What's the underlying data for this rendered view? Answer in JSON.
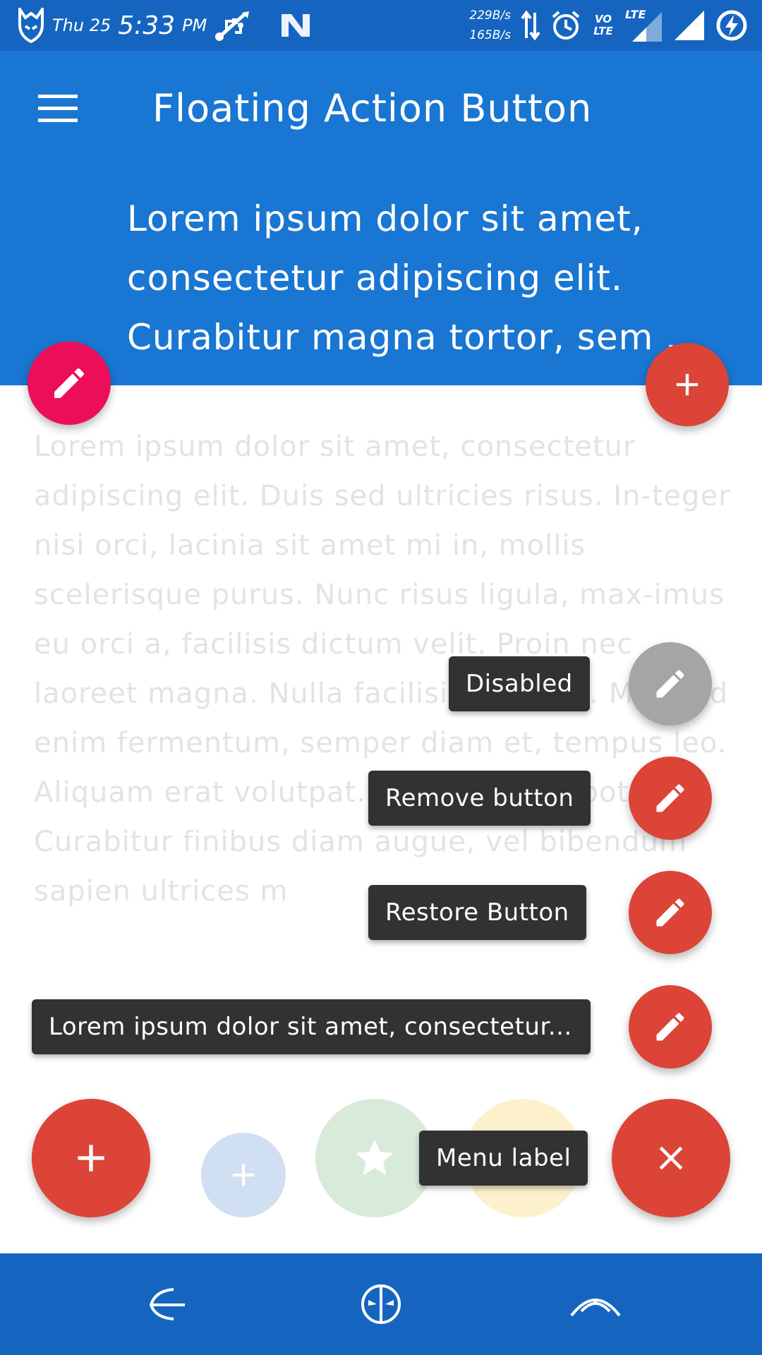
{
  "status_bar": {
    "day": "Thu 25",
    "time": "5:33",
    "ampm": "PM",
    "speed_up": "229B/s",
    "speed_down": "165B/s",
    "icons": [
      "app-logo-icon",
      "usb-icon",
      "n-icon",
      "data-arrows-icon",
      "alarm-icon",
      "volte-icon",
      "lte-signal-icon",
      "signal-icon",
      "battery-charging-icon"
    ],
    "volte_label": "VO LTE",
    "lte_label": "LTE"
  },
  "app_bar": {
    "title": "Floating Action Button",
    "header_text": [
      "Lorem ipsum dolor sit amet,",
      "consectetur adipiscing elit.",
      "Curabitur magna tortor, sem ..."
    ],
    "color": "#1976d2"
  },
  "body_text": "Lorem ipsum dolor sit amet, consectetur adipiscing elit. Duis sed ultricies risus. In-teger nisi orci, lacinia sit amet mi in, mollis scelerisque purus. Nunc risus ligula, max-imus eu orci a, facilisis dictum velit. Proin nec laoreet magna. Nulla facilisis lectus a. Morbi id enim fermentum, semper diam et, tempus leo. Aliquam erat volutpat. Sus-pendisse potenti. Curabitur finibus diam augue, vel bibendum sapien ultrices m",
  "fab_menu": {
    "items": [
      {
        "label": "Disabled",
        "icon": "pencil-icon",
        "enabled": false
      },
      {
        "label": "Remove button",
        "icon": "pencil-icon",
        "enabled": true
      },
      {
        "label": "Restore Button",
        "icon": "pencil-icon",
        "enabled": true
      },
      {
        "label": "Lorem ipsum dolor sit amet, consectetur...",
        "icon": "pencil-icon",
        "enabled": true
      }
    ],
    "main_label": "Menu label",
    "main_icon": "close-icon"
  },
  "colors": {
    "fab_red": "#db4437",
    "fab_pink": "#ec0e5a",
    "fab_disabled": "#a5a5a5",
    "label_bg": "#323232",
    "status_bar": "#1565c0"
  },
  "nav_bar": {
    "icons": [
      "back-icon",
      "home-icon",
      "recents-icon"
    ]
  }
}
